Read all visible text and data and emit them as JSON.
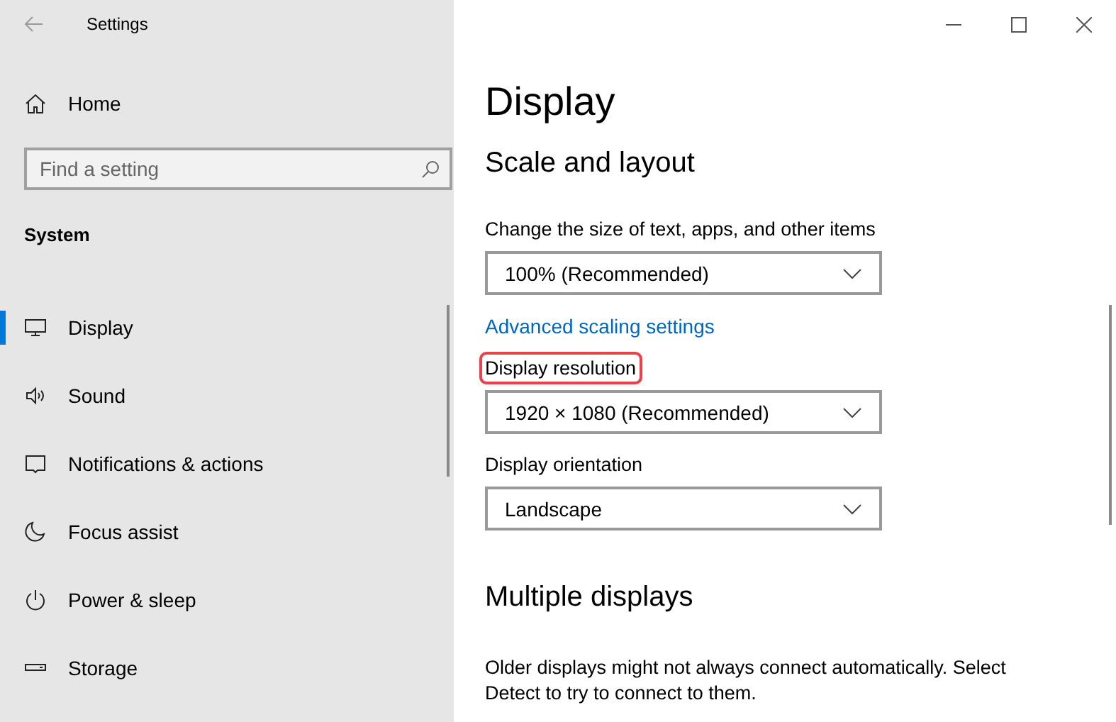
{
  "window": {
    "title": "Settings"
  },
  "sidebar": {
    "home": "Home",
    "search": {
      "placeholder": "Find a setting"
    },
    "section": "System",
    "items": [
      {
        "label": "Display",
        "kind": "display",
        "selected": true
      },
      {
        "label": "Sound",
        "kind": "sound",
        "selected": false
      },
      {
        "label": "Notifications & actions",
        "kind": "notifications",
        "selected": false
      },
      {
        "label": "Focus assist",
        "kind": "focus",
        "selected": false
      },
      {
        "label": "Power & sleep",
        "kind": "power",
        "selected": false
      },
      {
        "label": "Storage",
        "kind": "storage",
        "selected": false
      }
    ]
  },
  "page": {
    "title": "Display",
    "sections": [
      {
        "heading": "Scale and layout",
        "settings": [
          {
            "kind": "dropdown",
            "label": "Change the size of text, apps, and other items",
            "value": "100% (Recommended)",
            "highlighted": false
          },
          {
            "kind": "link",
            "label": "Advanced scaling settings"
          },
          {
            "kind": "dropdown",
            "label": "Display resolution",
            "value": "1920 × 1080 (Recommended)",
            "highlighted": true
          },
          {
            "kind": "dropdown",
            "label": "Display orientation",
            "value": "Landscape",
            "highlighted": false
          }
        ]
      },
      {
        "heading": "Multiple displays",
        "settings": [
          {
            "kind": "text",
            "label": "Older displays might not always connect automatically. Select Detect to try to connect to them."
          }
        ]
      }
    ]
  }
}
